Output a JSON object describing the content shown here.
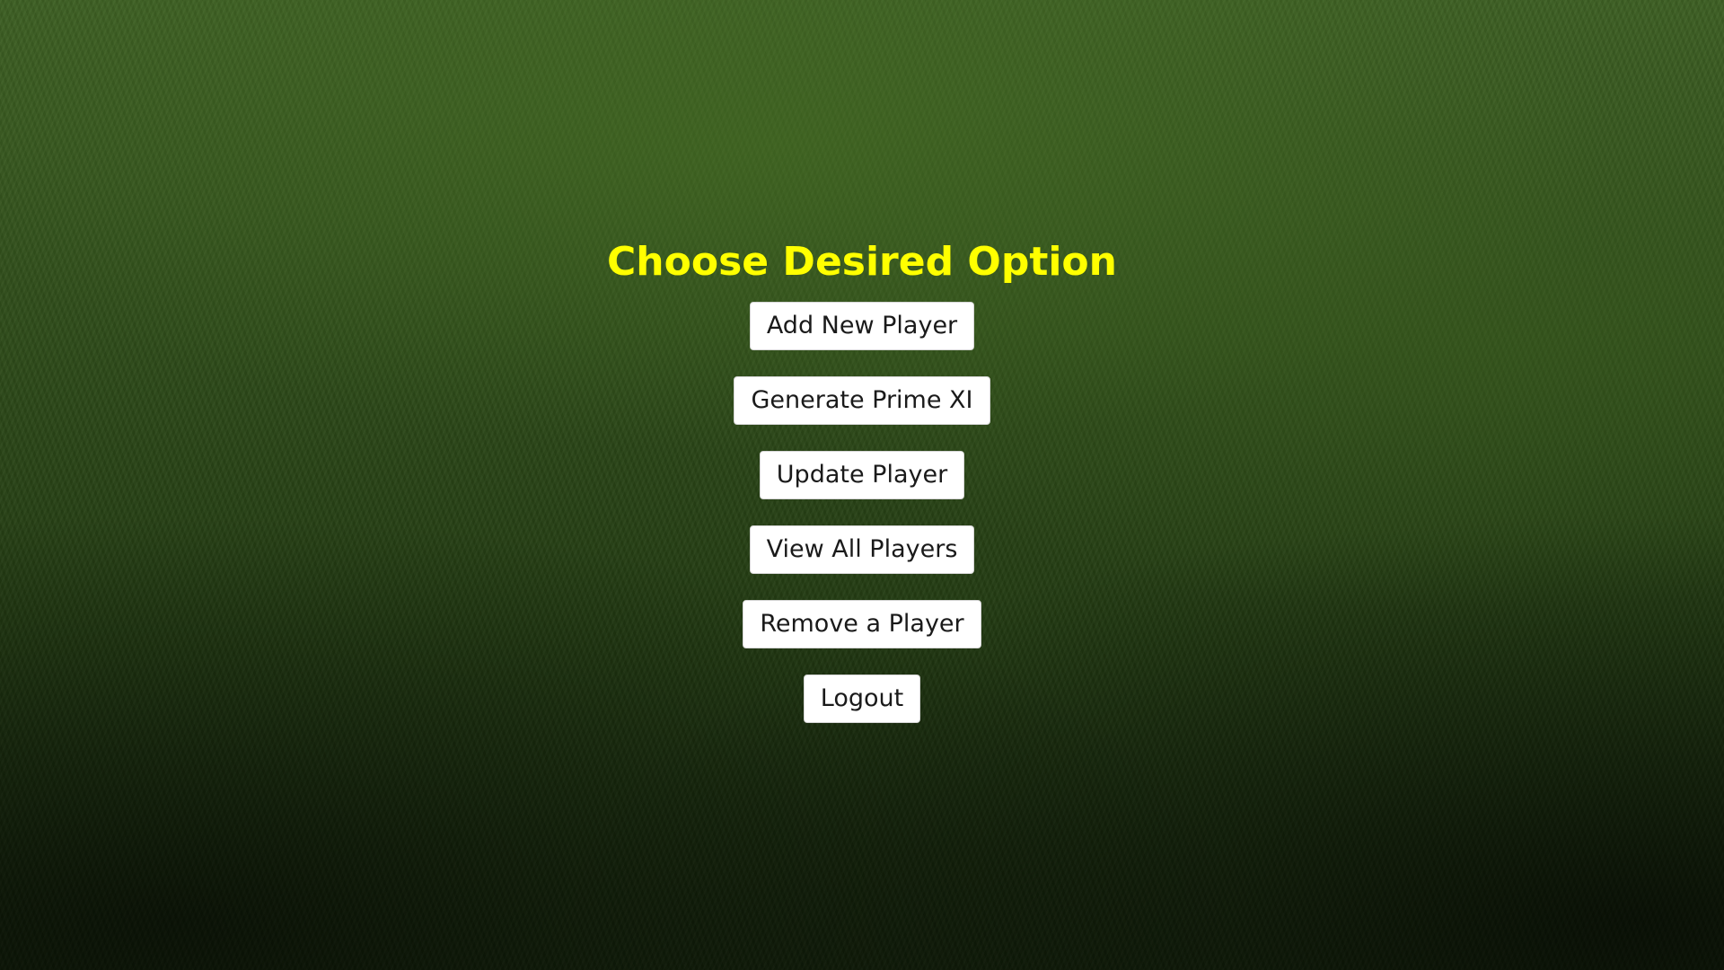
{
  "title": "Choose Desired Option",
  "options": {
    "add_new_player": "Add New Player",
    "generate_prime_xi": "Generate Prime XI",
    "update_player": "Update Player",
    "view_all_players": "View All Players",
    "remove_a_player": "Remove a Player",
    "logout": "Logout"
  },
  "colors": {
    "title": "#ffff00",
    "button_background": "#ffffff",
    "button_text": "#1a1a1a",
    "background": "#1f3712"
  }
}
